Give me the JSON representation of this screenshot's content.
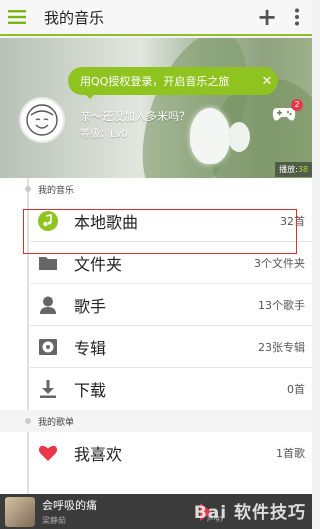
{
  "header": {
    "title": "我的音乐"
  },
  "banner": {
    "login_prompt": "用QQ授权登录，开启音乐之旅",
    "close_glyph": "✕",
    "greeting": "亲～还没加入多米吗？",
    "level": "等级：Lv0",
    "notification_count": "2",
    "play_label": "播放:",
    "play_count": "38"
  },
  "sections": {
    "my_music": "我的音乐",
    "my_playlists": "我的歌单"
  },
  "rows": [
    {
      "label": "本地歌曲",
      "count": "32首",
      "icon": "music-note-icon"
    },
    {
      "label": "文件夹",
      "count": "3个文件夹",
      "icon": "folder-icon"
    },
    {
      "label": "歌手",
      "count": "13个歌手",
      "icon": "person-icon"
    },
    {
      "label": "专辑",
      "count": "23张专辑",
      "icon": "disc-icon"
    },
    {
      "label": "下载",
      "count": "0首",
      "icon": "download-icon"
    }
  ],
  "favorites": {
    "label": "我喜欢",
    "count": "1首歌",
    "icon": "heart-icon"
  },
  "now_playing": {
    "title": "会呼吸的痛",
    "artist": "梁静茹"
  },
  "watermark": {
    "text": "Bai 软件技巧",
    "sub": "jingy"
  },
  "colors": {
    "accent": "#8fc31f",
    "badge": "#e8374a",
    "highlight_border": "#d9312e",
    "favorite": "#e8374a"
  }
}
